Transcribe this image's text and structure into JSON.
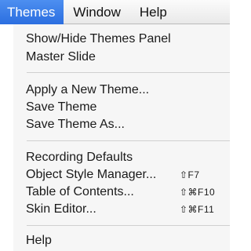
{
  "menubar": {
    "items": [
      {
        "label": "Themes"
      },
      {
        "label": "Window"
      },
      {
        "label": "Help"
      }
    ]
  },
  "themes_menu": {
    "group1": [
      {
        "label": "Show/Hide Themes Panel"
      },
      {
        "label": "Master Slide"
      }
    ],
    "group2": [
      {
        "label": "Apply a New Theme..."
      },
      {
        "label": "Save Theme"
      },
      {
        "label": "Save Theme As..."
      }
    ],
    "group3": [
      {
        "label": "Recording Defaults",
        "shortcut": ""
      },
      {
        "label": "Object Style Manager...",
        "shortcut": "⇧F7"
      },
      {
        "label": "Table of Contents...",
        "shortcut": "⇧⌘F10"
      },
      {
        "label": "Skin Editor...",
        "shortcut": "⇧⌘F11"
      }
    ],
    "group4": [
      {
        "label": "Help"
      }
    ]
  },
  "colors": {
    "active_menu": "#2b6ee0",
    "menu_bg": "#f6f6f6",
    "separator": "#d0d0d0"
  }
}
